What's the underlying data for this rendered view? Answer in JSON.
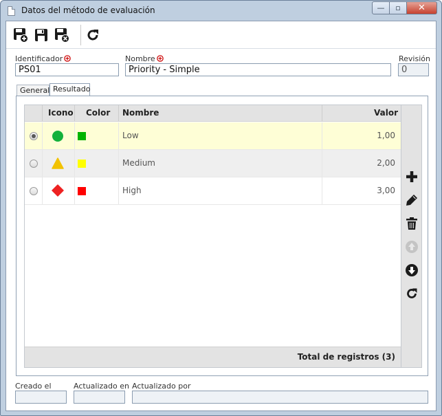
{
  "window": {
    "title": "Datos del método de evaluación",
    "minimize": "—",
    "maximize": "▫",
    "close": "✕"
  },
  "toolbar": {
    "icons": [
      "save-new-icon",
      "save-icon",
      "save-close-icon",
      "refresh-icon"
    ]
  },
  "form": {
    "identificador_label": "Identificador",
    "identificador_value": "PS01",
    "nombre_label": "Nombre",
    "nombre_value": "Priority - Simple",
    "revision_label": "Revisión",
    "revision_value": "0"
  },
  "tabs": [
    {
      "label": "General",
      "active": false
    },
    {
      "label": "Resultado",
      "active": true
    }
  ],
  "grid": {
    "columns": [
      "Icono",
      "Color",
      "Nombre",
      "Valor"
    ],
    "rows": [
      {
        "selected": true,
        "icon": "green-circle-icon",
        "color": "#00b400",
        "nombre": "Low",
        "valor": "1,00"
      },
      {
        "selected": false,
        "icon": "yellow-triangle-icon",
        "color": "#ffff00",
        "nombre": "Medium",
        "valor": "2,00"
      },
      {
        "selected": false,
        "icon": "red-diamond-icon",
        "color": "#ff0000",
        "nombre": "High",
        "valor": "3,00"
      }
    ],
    "total": "Total de registros (3)"
  },
  "side_actions": [
    "add-icon",
    "edit-icon",
    "delete-icon",
    "move-up-icon",
    "move-down-icon",
    "refresh-icon"
  ],
  "footer": {
    "creado_label": "Creado el",
    "creado_value": "",
    "actualizado_en_label": "Actualizado en",
    "actualizado_en_value": "",
    "actualizado_por_label": "Actualizado por",
    "actualizado_por_value": ""
  },
  "colors": {
    "selected_row": "#fefed6",
    "alt_row": "#efefef",
    "required_marker": "#cc0000"
  }
}
